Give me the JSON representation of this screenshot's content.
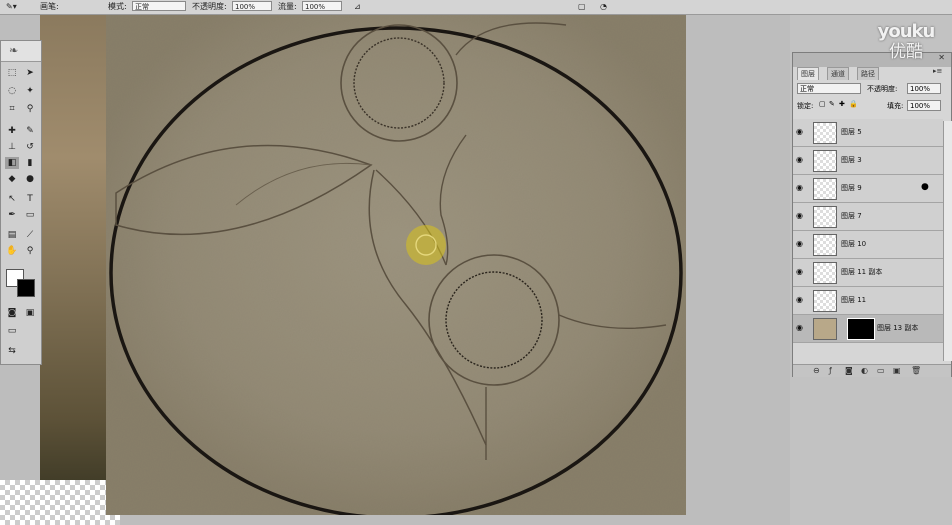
{
  "options_bar": {
    "items": [
      {
        "label": "画笔:",
        "x_text": "画笔:"
      },
      {
        "label": "模式:"
      },
      {
        "value": "正常"
      },
      {
        "label": "不透明度:"
      },
      {
        "value": "100%"
      },
      {
        "label": "流量:"
      },
      {
        "value": "100%"
      }
    ],
    "mode_label": "模式:",
    "mode_value": "正常",
    "opacity_label": "不透明度:",
    "opacity_value": "100%",
    "flow_label": "流量:",
    "flow_value": "100%",
    "brush_label": "画笔:"
  },
  "layers_panel": {
    "tabs": [
      "图层",
      "通道",
      "路径"
    ],
    "blend_mode": "正常",
    "opacity_label": "不透明度:",
    "opacity_value": "100%",
    "lock_label": "锁定:",
    "fill_label": "填充:",
    "fill_value": "100%",
    "layers": [
      {
        "name": "图层 5"
      },
      {
        "name": "图层 3"
      },
      {
        "name": "图层 9"
      },
      {
        "name": "图层 7"
      },
      {
        "name": "图层 10"
      },
      {
        "name": "图层 11 副本"
      },
      {
        "name": "图层 11"
      },
      {
        "name": "图层 13 副本"
      }
    ]
  },
  "watermark": {
    "line1": "youku",
    "line2": "优酷"
  },
  "colors": {
    "canvas_texture": "#938a74",
    "brush_cursor": "#d8c21a"
  }
}
